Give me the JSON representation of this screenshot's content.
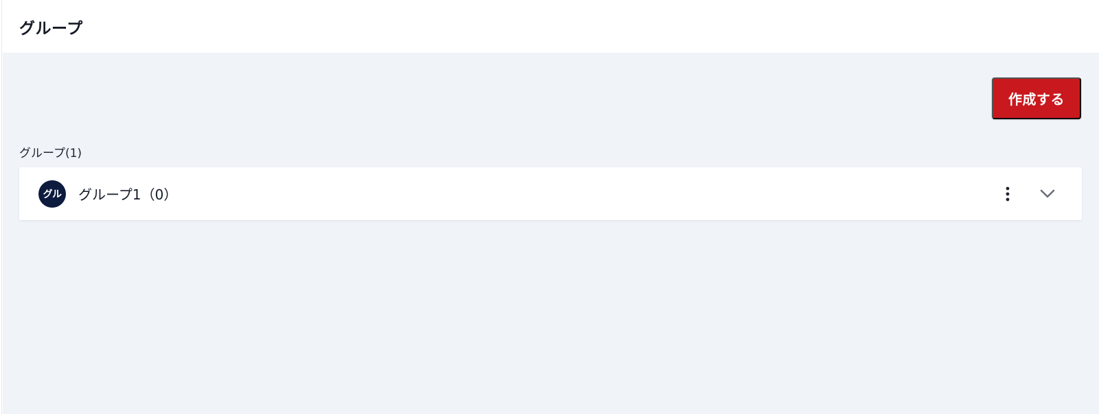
{
  "header": {
    "title": "グループ"
  },
  "toolbar": {
    "create_label": "作成する"
  },
  "groups_section": {
    "label": "グループ(1)",
    "items": [
      {
        "avatar_text": "グル",
        "name": "グループ1（0）",
        "more_icon": "more-vertical-icon",
        "expand_icon": "chevron-down-icon"
      }
    ]
  },
  "colors": {
    "accent": "#c9191e",
    "avatar_bg": "#0d1b3e",
    "page_bg": "#f0f3f8"
  }
}
